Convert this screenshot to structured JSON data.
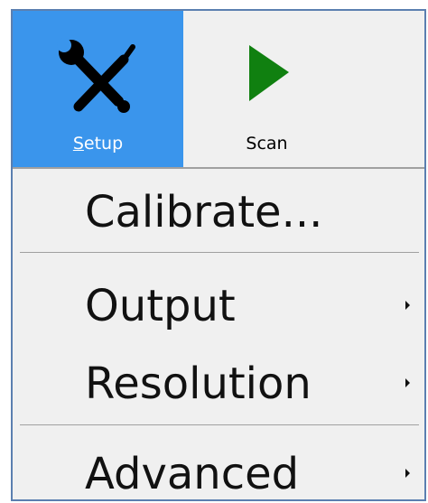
{
  "ribbon": {
    "setup": {
      "label_mnemonic": "S",
      "label_rest": "etup",
      "icon": "tools-icon"
    },
    "scan": {
      "label": "Scan",
      "icon": "play-icon"
    }
  },
  "menu": {
    "calibrate": "Calibrate...",
    "output": "Output",
    "resolution": "Resolution",
    "advanced": "Advanced"
  },
  "colors": {
    "accent": "#3a95ec",
    "scan_green": "#108010",
    "window_border": "#5b7fb0"
  }
}
